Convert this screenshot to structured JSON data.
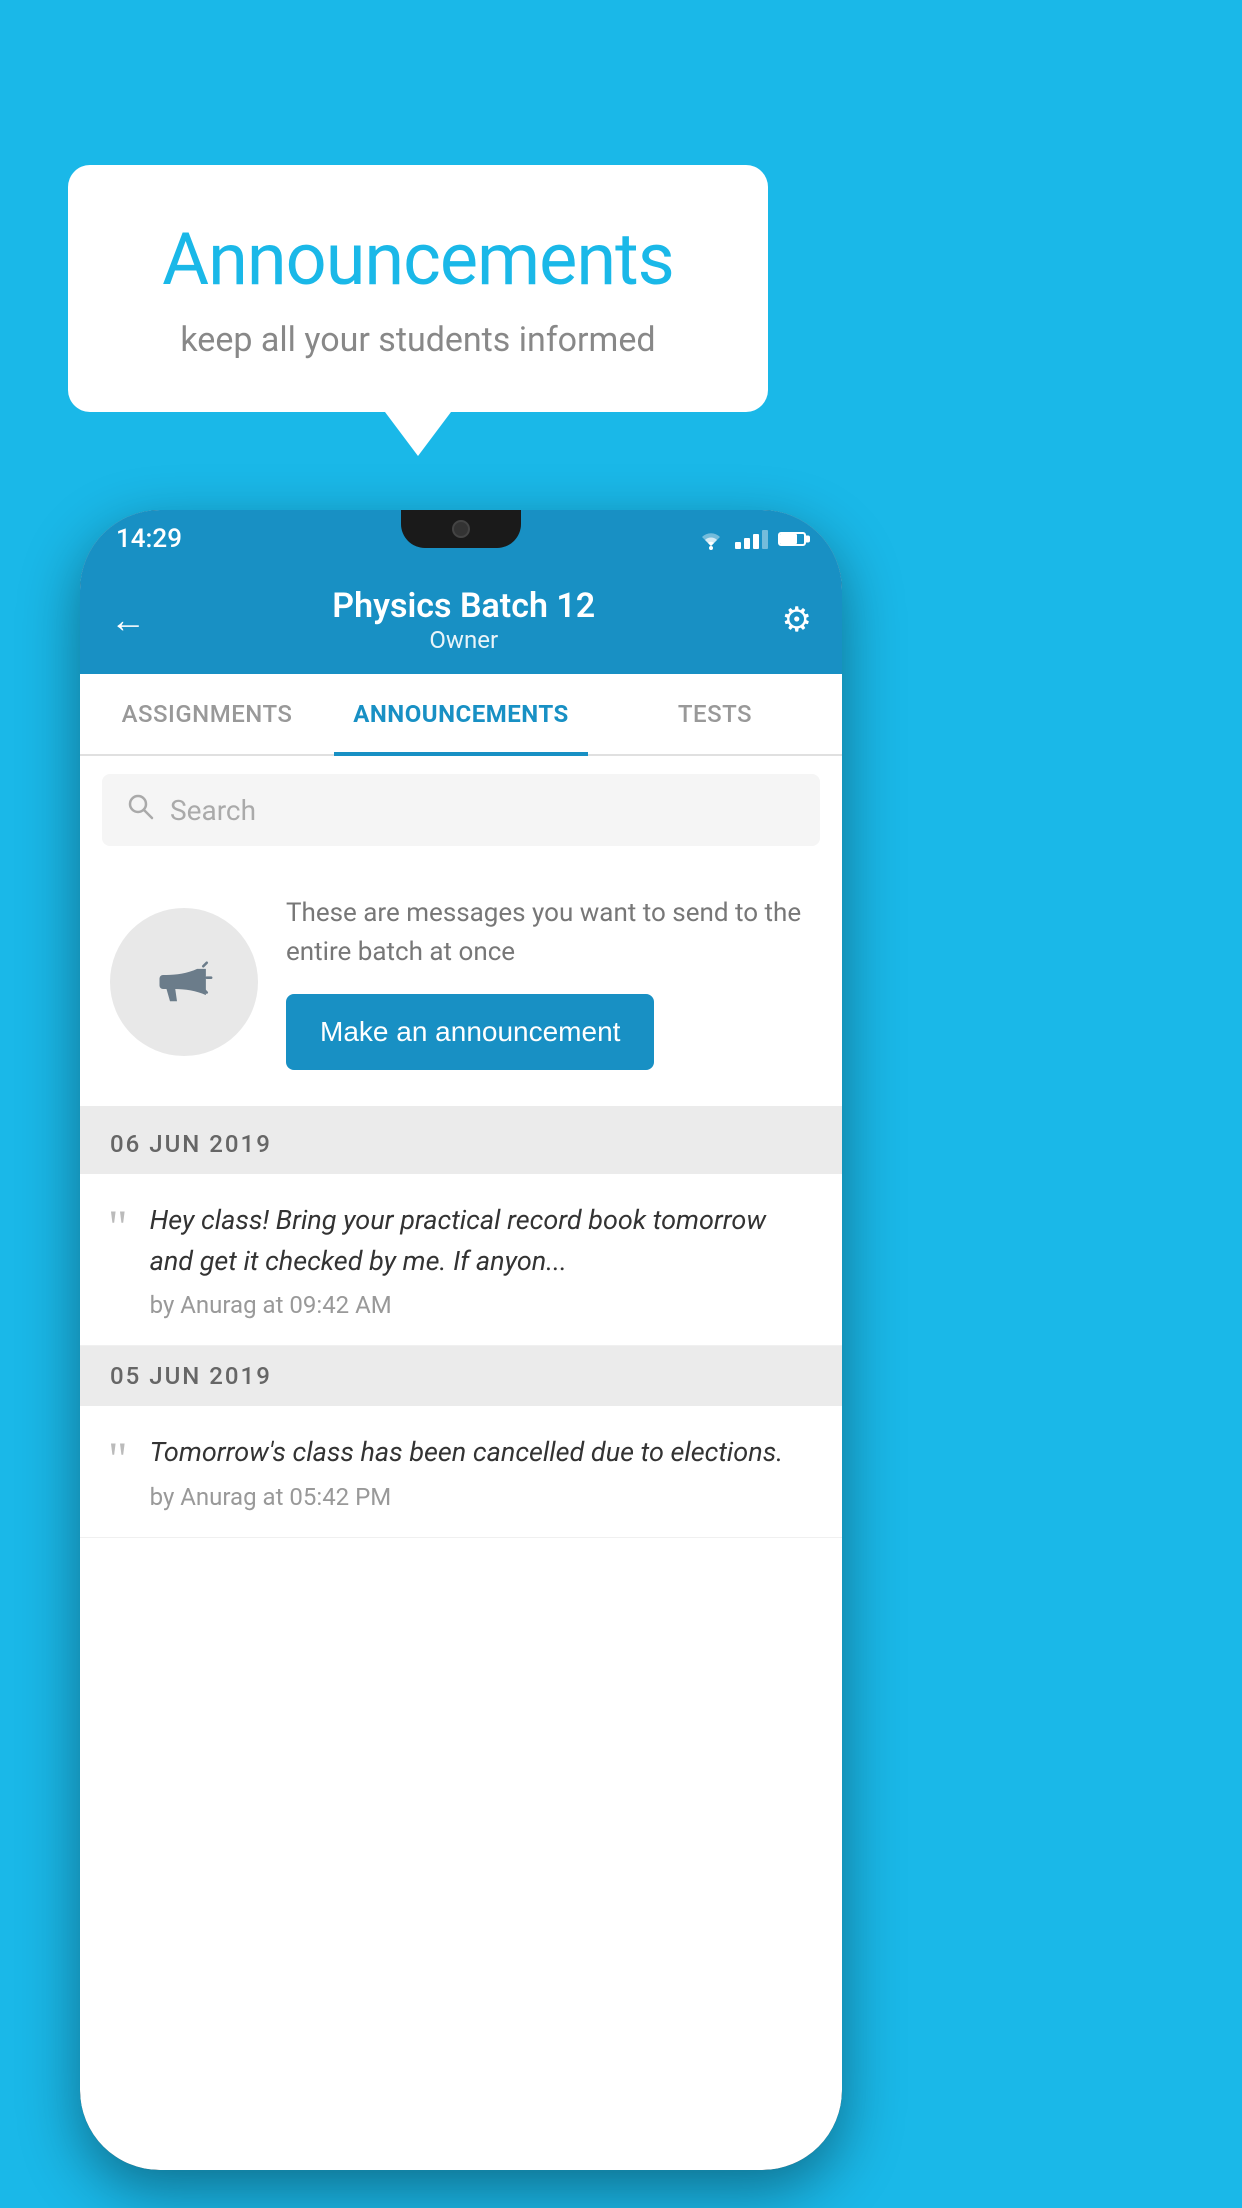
{
  "background_color": "#1ab8e8",
  "speech_bubble": {
    "title": "Announcements",
    "subtitle": "keep all your students informed"
  },
  "phone": {
    "status_bar": {
      "time": "14:29"
    },
    "header": {
      "back_label": "←",
      "title": "Physics Batch 12",
      "subtitle": "Owner",
      "gear_icon": "⚙"
    },
    "tabs": [
      {
        "label": "ASSIGNMENTS",
        "active": false
      },
      {
        "label": "ANNOUNCEMENTS",
        "active": true
      },
      {
        "label": "TESTS",
        "active": false
      }
    ],
    "search": {
      "placeholder": "Search"
    },
    "promo": {
      "description": "These are messages you want to send to the entire batch at once",
      "button_label": "Make an announcement"
    },
    "announcements": [
      {
        "date_label": "06  JUN  2019",
        "text": "Hey class! Bring your practical record book tomorrow and get it checked by me. If anyon...",
        "meta": "by Anurag at 09:42 AM"
      },
      {
        "date_label": "05  JUN  2019",
        "text": "Tomorrow's class has been cancelled due to elections.",
        "meta": "by Anurag at 05:42 PM"
      }
    ]
  }
}
